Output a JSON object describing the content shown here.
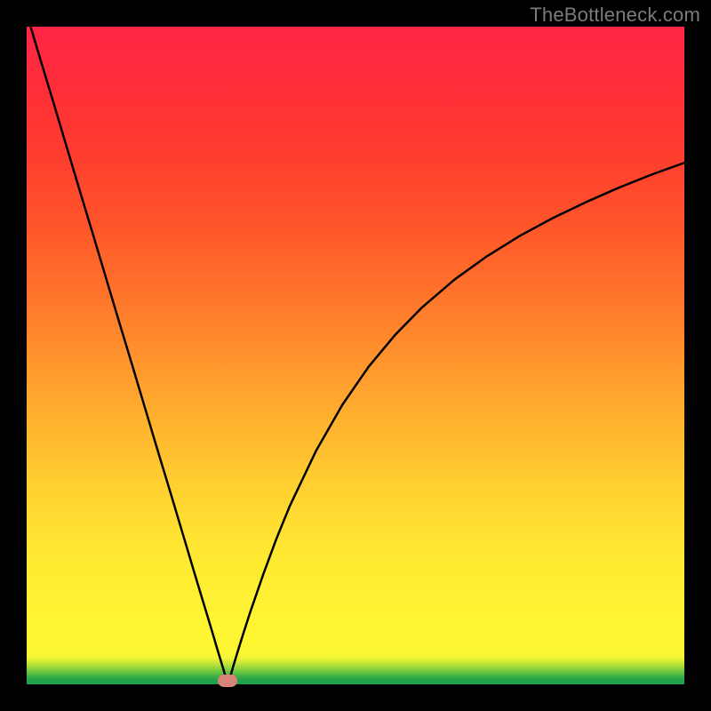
{
  "watermark": "TheBottleneck.com",
  "marker": {
    "x_pct": 0.306,
    "y_pct": 0.005
  },
  "chart_data": {
    "type": "line",
    "title": "",
    "xlabel": "",
    "ylabel": "",
    "xlim": [
      0,
      1
    ],
    "ylim": [
      0,
      1
    ],
    "series": [
      {
        "name": "curve",
        "x": [
          0.0,
          0.02,
          0.04,
          0.06,
          0.08,
          0.1,
          0.12,
          0.14,
          0.16,
          0.18,
          0.2,
          0.22,
          0.24,
          0.26,
          0.28,
          0.29,
          0.3,
          0.303,
          0.306,
          0.31,
          0.314,
          0.32,
          0.33,
          0.34,
          0.36,
          0.38,
          0.4,
          0.44,
          0.48,
          0.52,
          0.56,
          0.6,
          0.65,
          0.7,
          0.75,
          0.8,
          0.85,
          0.9,
          0.95,
          1.0
        ],
        "y": [
          1.02,
          0.953,
          0.887,
          0.82,
          0.753,
          0.687,
          0.62,
          0.553,
          0.487,
          0.42,
          0.353,
          0.287,
          0.22,
          0.153,
          0.087,
          0.053,
          0.02,
          0.01,
          0.005,
          0.013,
          0.027,
          0.047,
          0.079,
          0.11,
          0.168,
          0.222,
          0.271,
          0.355,
          0.425,
          0.483,
          0.531,
          0.572,
          0.615,
          0.651,
          0.682,
          0.709,
          0.733,
          0.755,
          0.775,
          0.793
        ]
      }
    ],
    "gradient_stops": [
      {
        "pct": 0.0,
        "color": "#209e4a"
      },
      {
        "pct": 0.008,
        "color": "#25a34a"
      },
      {
        "pct": 0.016,
        "color": "#56bd43"
      },
      {
        "pct": 0.024,
        "color": "#8dd23d"
      },
      {
        "pct": 0.032,
        "color": "#c4e637"
      },
      {
        "pct": 0.04,
        "color": "#f1f634"
      },
      {
        "pct": 0.05,
        "color": "#fdf734"
      },
      {
        "pct": 0.06,
        "color": "#fff633"
      },
      {
        "pct": 0.1,
        "color": "#fff433"
      },
      {
        "pct": 0.2,
        "color": "#ffe832"
      },
      {
        "pct": 0.3,
        "color": "#ffd030"
      },
      {
        "pct": 0.4,
        "color": "#ffb22e"
      },
      {
        "pct": 0.5,
        "color": "#ff922d"
      },
      {
        "pct": 0.6,
        "color": "#ff722b"
      },
      {
        "pct": 0.7,
        "color": "#ff552a"
      },
      {
        "pct": 0.8,
        "color": "#ff3e2e"
      },
      {
        "pct": 0.9,
        "color": "#ff2f38"
      },
      {
        "pct": 1.0,
        "color": "#ff2545"
      }
    ]
  }
}
